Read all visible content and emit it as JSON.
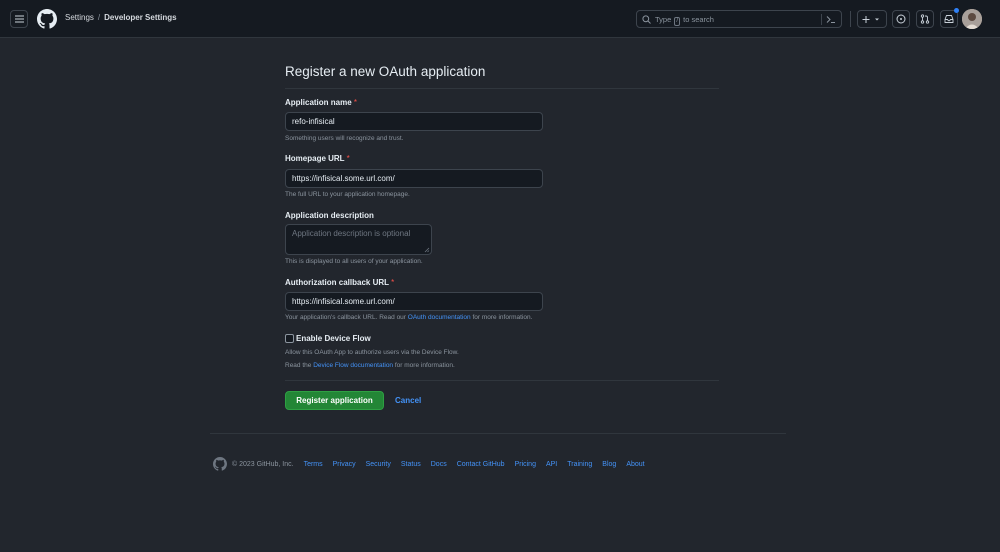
{
  "header": {
    "breadcrumbs": [
      "Settings",
      "Developer Settings"
    ],
    "separator": "/",
    "search": {
      "prefix": "Type",
      "key": "/",
      "suffix": "to search"
    }
  },
  "form": {
    "title": "Register a new OAuth application",
    "required_mark": "*",
    "app_name": {
      "label": "Application name",
      "value": "refo-infisical",
      "hint": "Something users will recognize and trust."
    },
    "homepage": {
      "label": "Homepage URL",
      "value": "https://infisical.some.url.com/",
      "hint": "The full URL to your application homepage."
    },
    "description": {
      "label": "Application description",
      "placeholder": "Application description is optional",
      "hint": "This is displayed to all users of your application."
    },
    "callback": {
      "label": "Authorization callback URL",
      "value": "https://infisical.some.url.com/",
      "hint_pre": "Your application's callback URL. Read our",
      "hint_link": "OAuth documentation",
      "hint_post": "for more information."
    },
    "device_flow": {
      "label": "Enable Device Flow",
      "checked": false,
      "hint1": "Allow this OAuth App to authorize users via the Device Flow.",
      "hint2_pre": "Read the",
      "hint2_link": "Device Flow documentation",
      "hint2_post": "for more information."
    },
    "submit_label": "Register application",
    "cancel_label": "Cancel"
  },
  "footer": {
    "copyright": "© 2023 GitHub, Inc.",
    "links": [
      "Terms",
      "Privacy",
      "Security",
      "Status",
      "Docs",
      "Contact GitHub",
      "Pricing",
      "API",
      "Training",
      "Blog",
      "About"
    ]
  },
  "colors": {
    "accent": "#238636",
    "link": "#4493f8",
    "required": "#f85149",
    "background": "#22262d",
    "header": "#151a21"
  }
}
